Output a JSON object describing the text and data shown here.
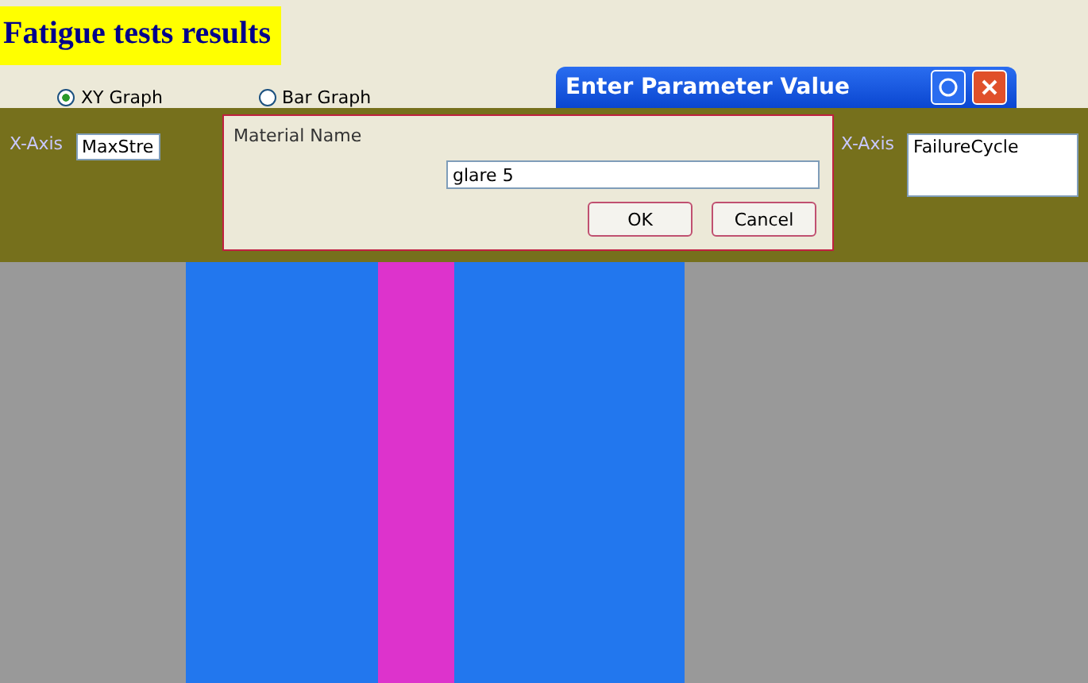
{
  "title": "Fatigue tests results",
  "graph_types": [
    {
      "label": "XY Graph",
      "selected": true
    },
    {
      "label": "Bar Graph",
      "selected": false
    }
  ],
  "left_panel": {
    "axis_label": "X-Axis",
    "field_value": "MaxStre"
  },
  "right_panel": {
    "axis_label": "X-Axis",
    "field_value": "FailureCycle"
  },
  "dialog": {
    "title": "Enter Parameter Value",
    "prompt": "Material Name",
    "value": "glare 5",
    "buttons": [
      "OK",
      "Cancel"
    ]
  }
}
